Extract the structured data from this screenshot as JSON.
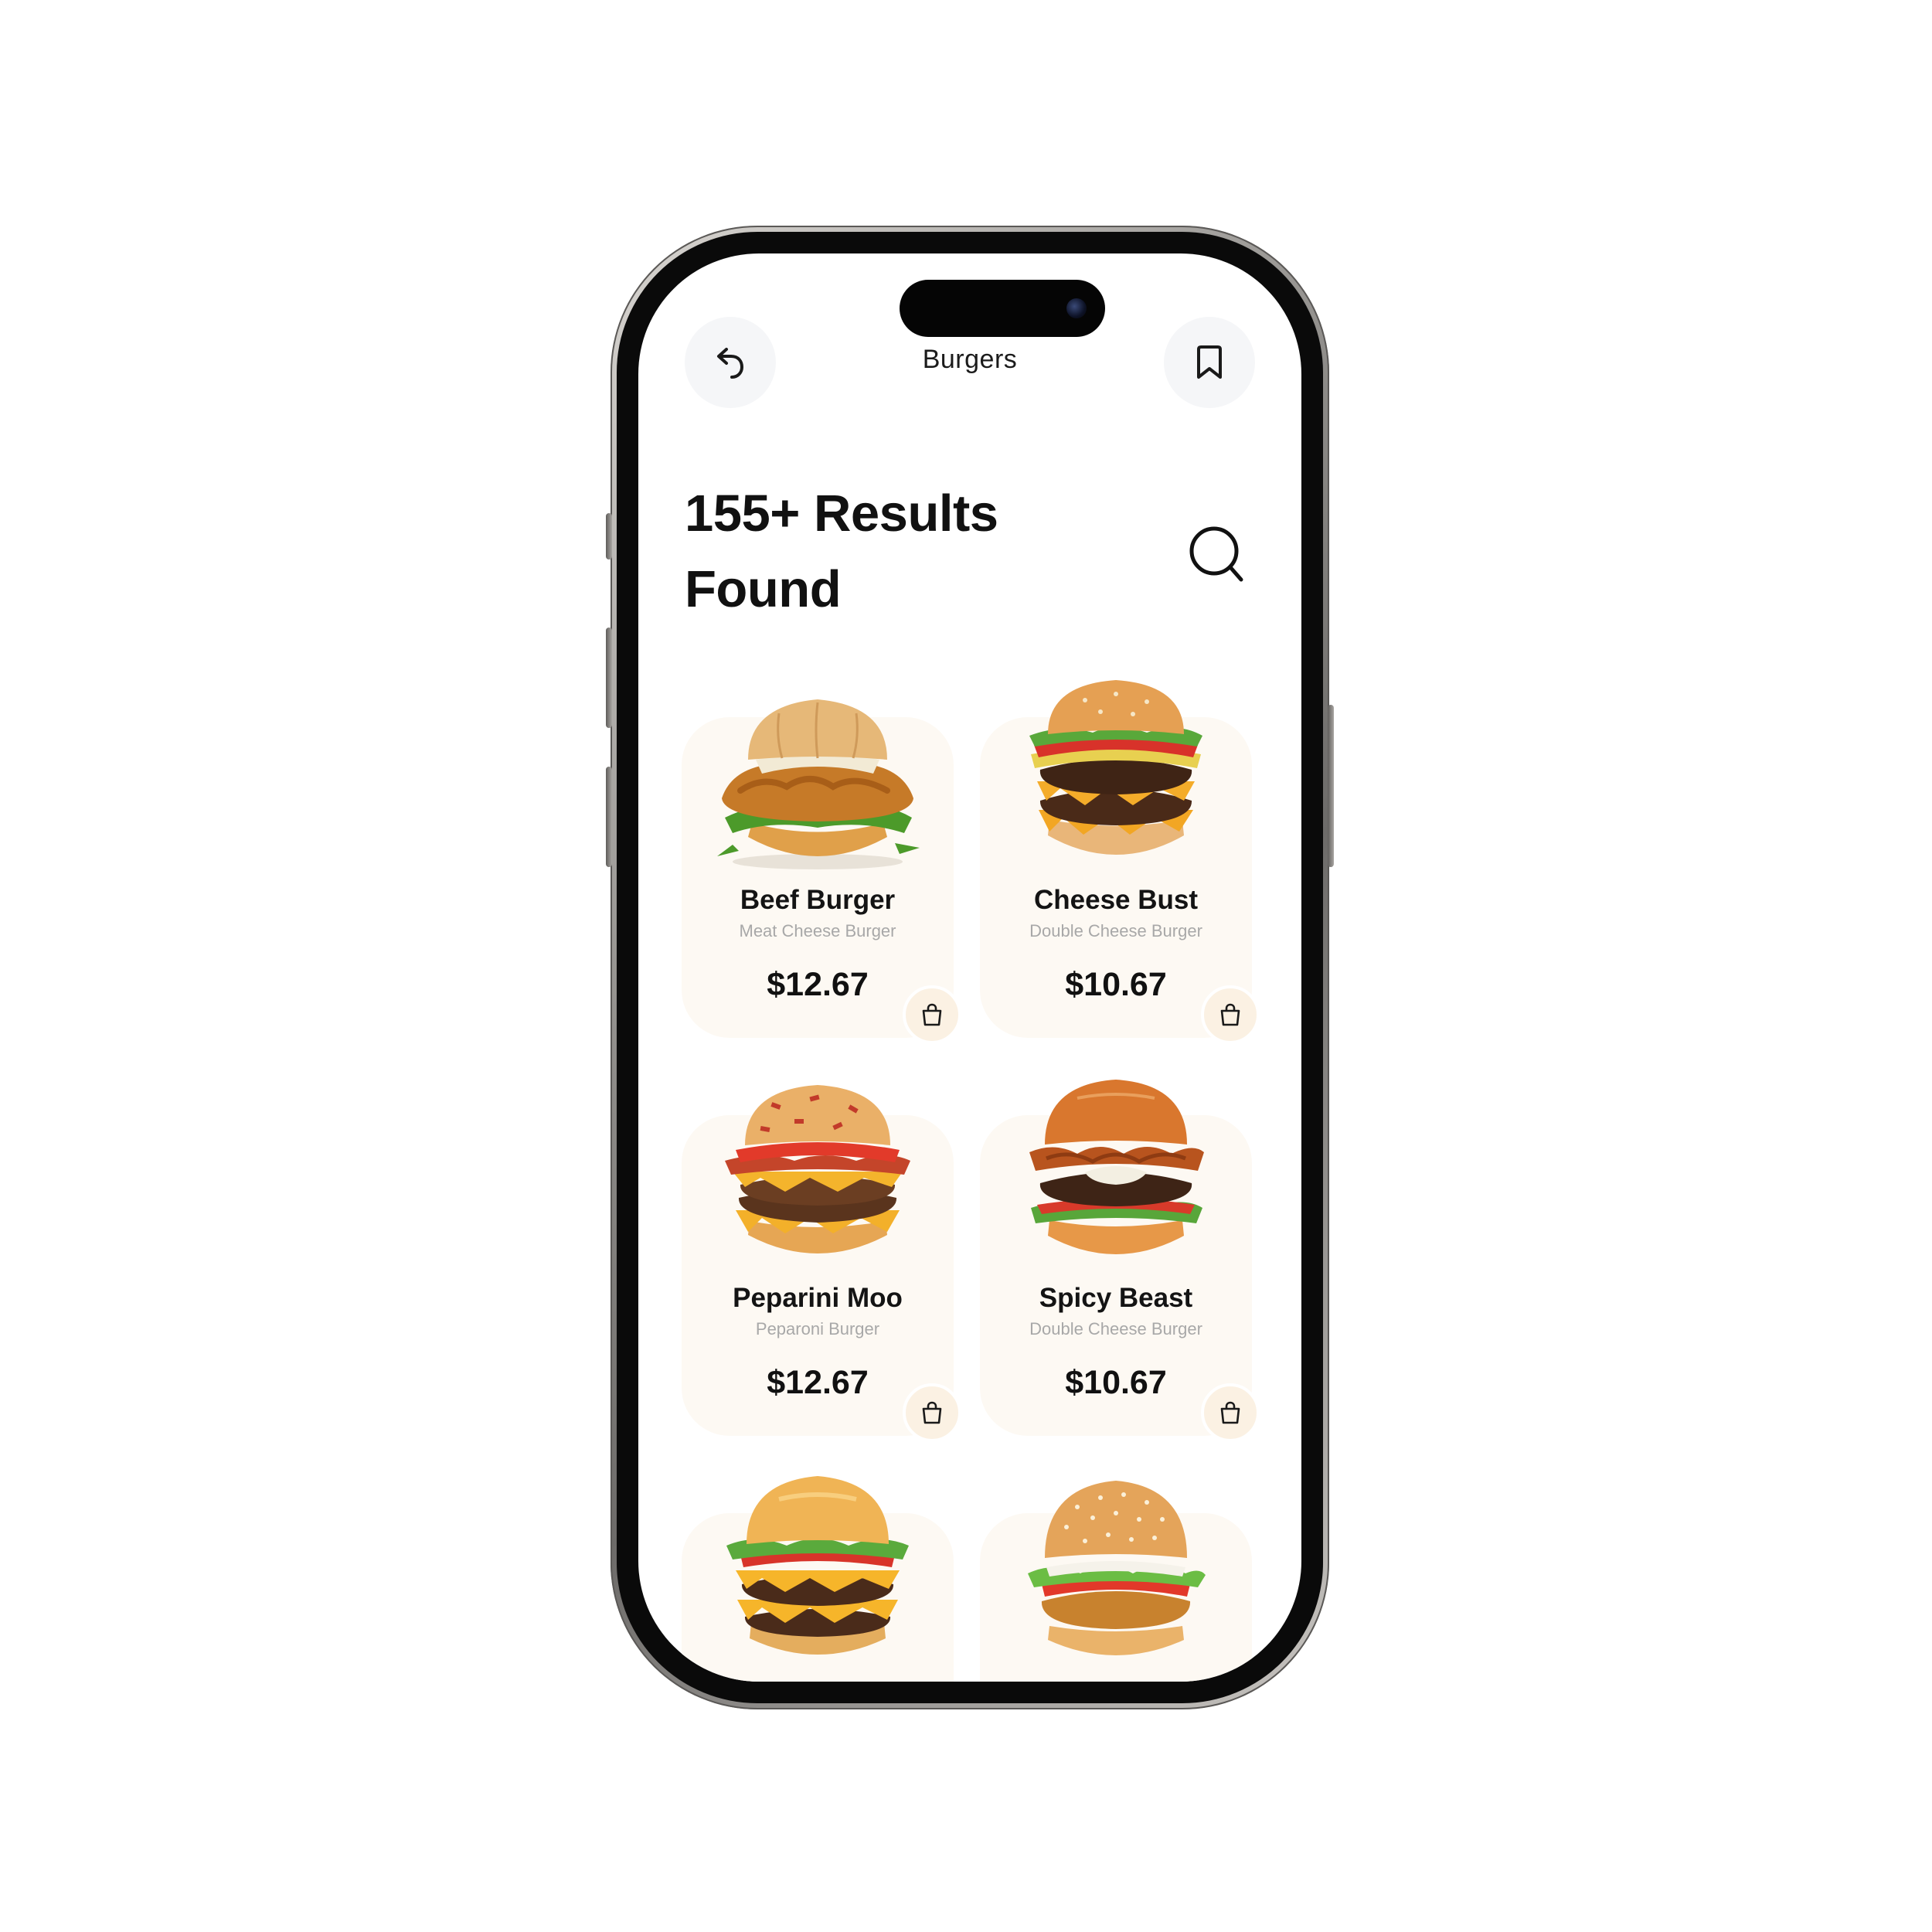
{
  "header": {
    "title": "Burgers",
    "back_icon": "undo-arrow-icon",
    "bookmark_icon": "bookmark-icon"
  },
  "results": {
    "line1": "155+ Results",
    "line2": "Found",
    "search_icon": "search-icon"
  },
  "products": [
    {
      "name": "Beef Burger",
      "subtitle": "Meat Cheese Burger",
      "price": "$12.67",
      "image": "crispy-chicken-burger-image"
    },
    {
      "name": "Cheese Bust",
      "subtitle": "Double Cheese Burger",
      "price": "$10.67",
      "image": "double-cheeseburger-image"
    },
    {
      "name": "Peparini Moo",
      "subtitle": "Peparoni Burger",
      "price": "$12.67",
      "image": "bacon-cheeseburger-image"
    },
    {
      "name": "Spicy Beast",
      "subtitle": "Double Cheese Burger",
      "price": "$10.67",
      "image": "onion-crunch-burger-image"
    },
    {
      "image": "double-beef-burger-image"
    },
    {
      "image": "sesame-veggie-burger-image"
    }
  ],
  "colors": {
    "card_bg": "#fdf9f3",
    "cart_btn_bg": "#fbf1e3",
    "round_btn_bg": "#f5f6f8",
    "text_dark": "#111111",
    "text_muted": "#a8a8a8"
  }
}
